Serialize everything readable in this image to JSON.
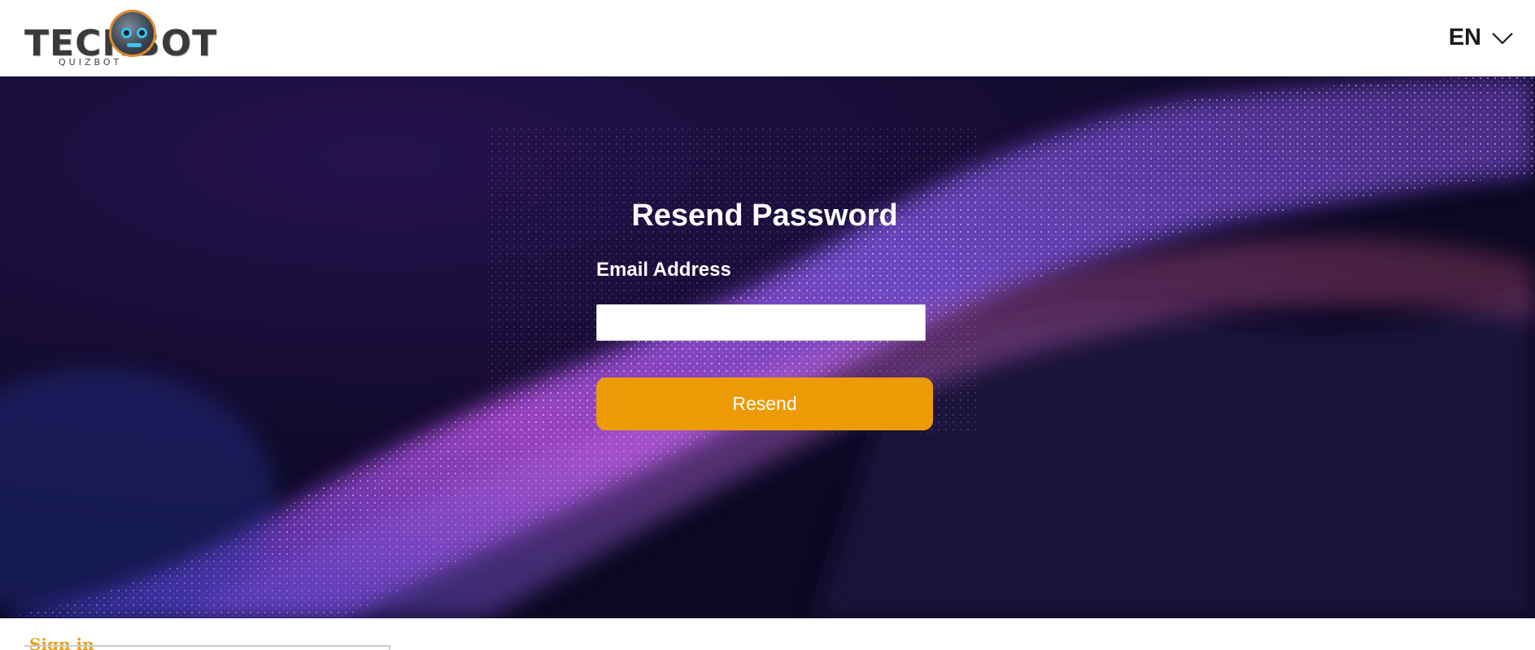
{
  "header": {
    "logo_text": "TECHBOT",
    "logo_sub": "QUIZBOT",
    "language": "EN"
  },
  "form": {
    "title": "Resend Password",
    "email_label": "Email Address",
    "email_value": "",
    "resend_label": "Resend"
  },
  "footer": {
    "signin_label": "Sign in"
  },
  "colors": {
    "accent": "#ed9a07",
    "hero_bg": "#0d0a2a",
    "signin": "#e8a11a"
  },
  "icons": {
    "language_toggle": "chevron-down-icon",
    "logo": "robot-logo-icon"
  }
}
